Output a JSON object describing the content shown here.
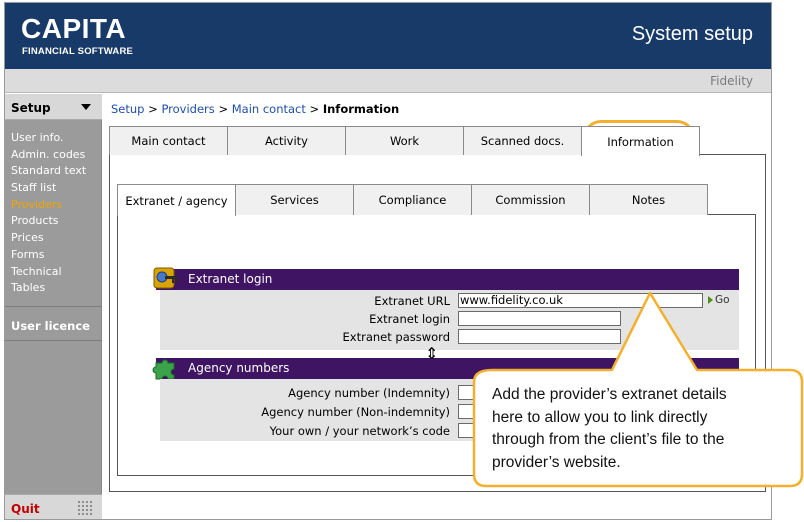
{
  "header": {
    "logo_main": "CAPITA",
    "logo_sub": "FINANCIAL SOFTWARE",
    "title": "System setup",
    "provider": "Fidelity"
  },
  "sidebar": {
    "heading": "Setup",
    "items": [
      {
        "label": "User info.",
        "active": false
      },
      {
        "label": "Admin. codes",
        "active": false
      },
      {
        "label": "Standard text",
        "active": false
      },
      {
        "label": "Staff list",
        "active": false
      },
      {
        "label": "Providers",
        "active": true
      },
      {
        "label": "Products",
        "active": false
      },
      {
        "label": "Prices",
        "active": false
      },
      {
        "label": "Forms",
        "active": false
      },
      {
        "label": "Technical",
        "active": false
      },
      {
        "label": "Tables",
        "active": false
      }
    ],
    "licence": "User licence",
    "quit": "Quit"
  },
  "breadcrumb": {
    "setup": "Setup",
    "providers": "Providers",
    "main_contact": "Main contact",
    "current": "Information",
    "sep": ">"
  },
  "tabs": [
    "Main contact",
    "Activity",
    "Work",
    "Scanned docs.",
    "Information"
  ],
  "subtabs": [
    "Extranet / agency",
    "Services",
    "Compliance",
    "Commission",
    "Notes"
  ],
  "extranet": {
    "title": "Extranet login",
    "url_label": "Extranet URL",
    "url_value": "www.fidelity.co.uk",
    "go": "Go",
    "login_label": "Extranet login",
    "login_value": "",
    "password_label": "Extranet password",
    "password_value": ""
  },
  "agency": {
    "title": "Agency numbers",
    "indemnity_label": "Agency number (Indemnity)",
    "indemnity_value": "",
    "nonindemnity_label": "Agency number (Non-indemnity)",
    "nonindemnity_value": "",
    "own_code_label": "Your own / your network’s code",
    "own_code_value": ""
  },
  "callout": {
    "line1": "Add the provider’s extranet details",
    "line2": "here to allow you to link directly",
    "line3": "through from the client’s file to the",
    "line4": "provider’s website."
  },
  "colors": {
    "header": "#183a68",
    "section_bar": "#3e1463",
    "active_sidebar": "#f0a500",
    "callout_border": "#f2b02e"
  }
}
